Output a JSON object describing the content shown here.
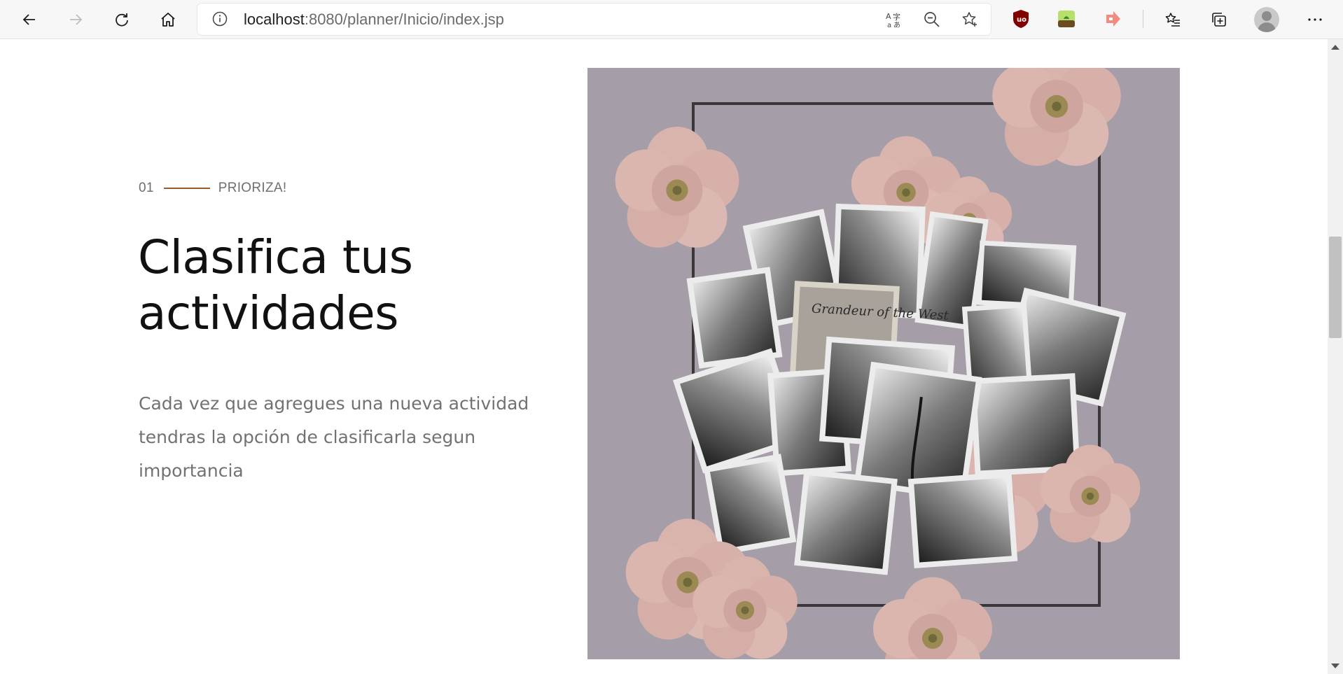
{
  "browser": {
    "url_host": "localhost",
    "url_rest": ":8080/planner/Inicio/index.jsp",
    "icons": [
      "back-icon",
      "forward-icon",
      "refresh-icon",
      "home-icon",
      "site-info-icon",
      "translate-icon",
      "zoom-out-icon",
      "favorite-star-icon",
      "ublock-extension-icon",
      "extension-icon",
      "arrow-extension-icon",
      "favorites-list-icon",
      "collections-icon",
      "profile-avatar",
      "more-menu-icon"
    ]
  },
  "section": {
    "number": "01",
    "eyebrow": "PRIORIZA!",
    "title": "Clasifica tus actividades",
    "description": "Cada vez que agregues una nueva actividad tendras la opción de clasificarla segun importancia"
  },
  "hero_image": {
    "postcard_text": "Grandeur of the West"
  },
  "colors": {
    "accent_line": "#9a5a2a",
    "image_background": "#a59da7",
    "flower": "#d9b4ad",
    "heading": "#111111",
    "body_text": "#727272"
  }
}
